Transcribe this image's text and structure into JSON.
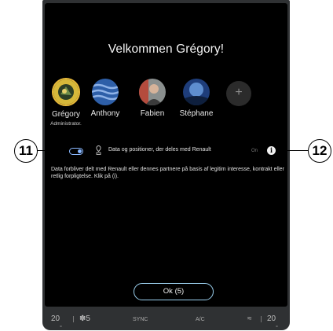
{
  "welcome": {
    "title": "Velkommen Grégory!"
  },
  "profiles": [
    {
      "name": "Grégory",
      "role": "Administrator."
    },
    {
      "name": "Anthony"
    },
    {
      "name": "Fabien"
    },
    {
      "name": "Stéphane"
    }
  ],
  "add_profile": {
    "symbol": "+"
  },
  "callouts": {
    "left": "11",
    "right": "12"
  },
  "data_sharing": {
    "label": "Data og positioner, der deles med Renault",
    "state": "On",
    "info_symbol": "i",
    "description": "Data forbliver delt med Renault eller dennes partnere på basis af legitim interesse, kontrakt eller retlig forpligtelse. Klik på (i)."
  },
  "ok_button": {
    "label": "Ok (5)"
  },
  "footer": {
    "temp_left": "20",
    "fan_level": "5",
    "sync_label": "SYNC",
    "ac_label": "A/C",
    "temp_right": "20"
  },
  "colors": {
    "accent": "#8ab8ff",
    "admin_ring": "#e8b93a",
    "ok_border": "#9bd0ee"
  }
}
